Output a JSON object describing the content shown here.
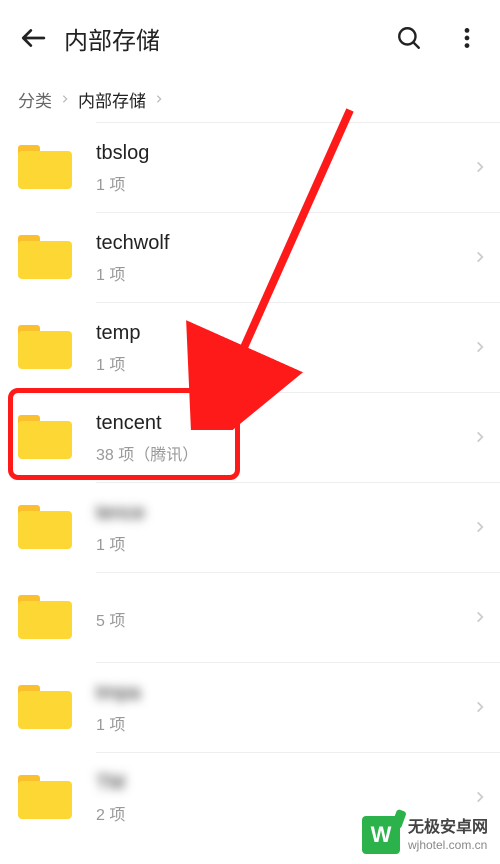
{
  "header": {
    "title": "内部存储"
  },
  "breadcrumb": {
    "root": "分类",
    "current": "内部存储"
  },
  "folders": [
    {
      "name": "tbslog",
      "sub": "1 项"
    },
    {
      "name": "techwolf",
      "sub": "1 项"
    },
    {
      "name": "temp",
      "sub": "1 项"
    },
    {
      "name": "tencent",
      "sub": "38 项（腾讯）",
      "highlight": true
    },
    {
      "name": "tence",
      "sub": "1 项",
      "blurName": true
    },
    {
      "name": "",
      "sub": "5 项",
      "blurName": true
    },
    {
      "name": "tmpa",
      "sub": "1 项",
      "blurName": true
    },
    {
      "name": "TM",
      "sub": "2 项",
      "blurName": true
    }
  ],
  "watermark": {
    "logo": "W",
    "line1": "无极安卓网",
    "line2": "wjhotel.com.cn"
  }
}
